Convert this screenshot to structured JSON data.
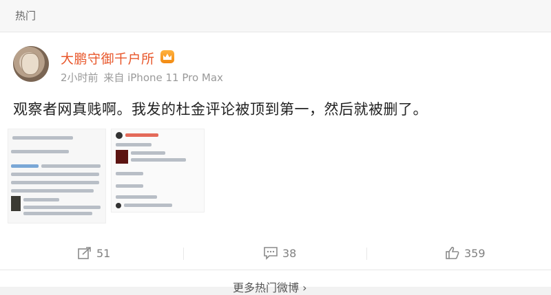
{
  "section": {
    "title": "热门"
  },
  "post": {
    "author": "大鹏守御千户所",
    "badge_icon": "vip-crown-icon",
    "time": "2小时前",
    "source": "来自 iPhone 11 Pro Max",
    "text": "观察者网真贱啊。我发的杜金评论被顶到第一，然后就被删了。",
    "images": [
      {
        "icon": "screenshot-thumbnail-1"
      },
      {
        "icon": "screenshot-thumbnail-2"
      }
    ]
  },
  "actions": {
    "repost": {
      "icon": "share-icon",
      "count": "51"
    },
    "comment": {
      "icon": "comment-icon",
      "count": "38"
    },
    "like": {
      "icon": "thumbs-up-icon",
      "count": "359"
    }
  },
  "footer": {
    "more_label": "更多热门微博 ›"
  },
  "colors": {
    "author": "#e8562a",
    "muted": "#999999",
    "background": "#f2f2f2"
  }
}
